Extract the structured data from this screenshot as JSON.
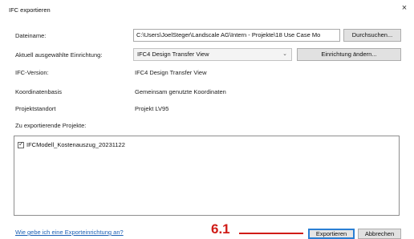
{
  "dialog": {
    "title": "IFC exportieren",
    "close_glyph": "×"
  },
  "filename": {
    "label": "Dateiname:",
    "value": "C:\\Users\\JoelSteger\\Landscale AG\\Intern - Projekte\\18 Use Case Mo",
    "browse_label": "Durchsuchen..."
  },
  "setup": {
    "label": "Aktuell ausgewählte Einrichtung:",
    "selected": "IFC4 Design Transfer View",
    "change_label": "Einrichtung ändern..."
  },
  "ifc_version": {
    "label": "IFC-Version:",
    "value": "IFC4 Design Transfer View"
  },
  "coordinates": {
    "label": "Koordinatenbasis",
    "value": "Gemeinsam genutzte Koordinaten"
  },
  "location": {
    "label": "Projektstandort",
    "value": "Projekt LV95"
  },
  "projects": {
    "label": "Zu exportierende Projekte:",
    "items": [
      {
        "name": "IFCModell_Kostenauszug_20231122",
        "checked": true,
        "check_glyph": "✓"
      }
    ]
  },
  "footer": {
    "help_link": "Wie gebe ich eine Exporteinrichtung an?",
    "export_label": "Exportieren",
    "cancel_label": "Abbrechen"
  },
  "annotation": {
    "text": "6.1",
    "color": "#d01c17"
  },
  "colors": {
    "primary_button_border": "#2a7fd4",
    "link": "#1a5fb4"
  },
  "icons": {
    "close": "close-icon",
    "dropdown": "chevron-down-icon",
    "checkbox": "checkmark-icon"
  }
}
